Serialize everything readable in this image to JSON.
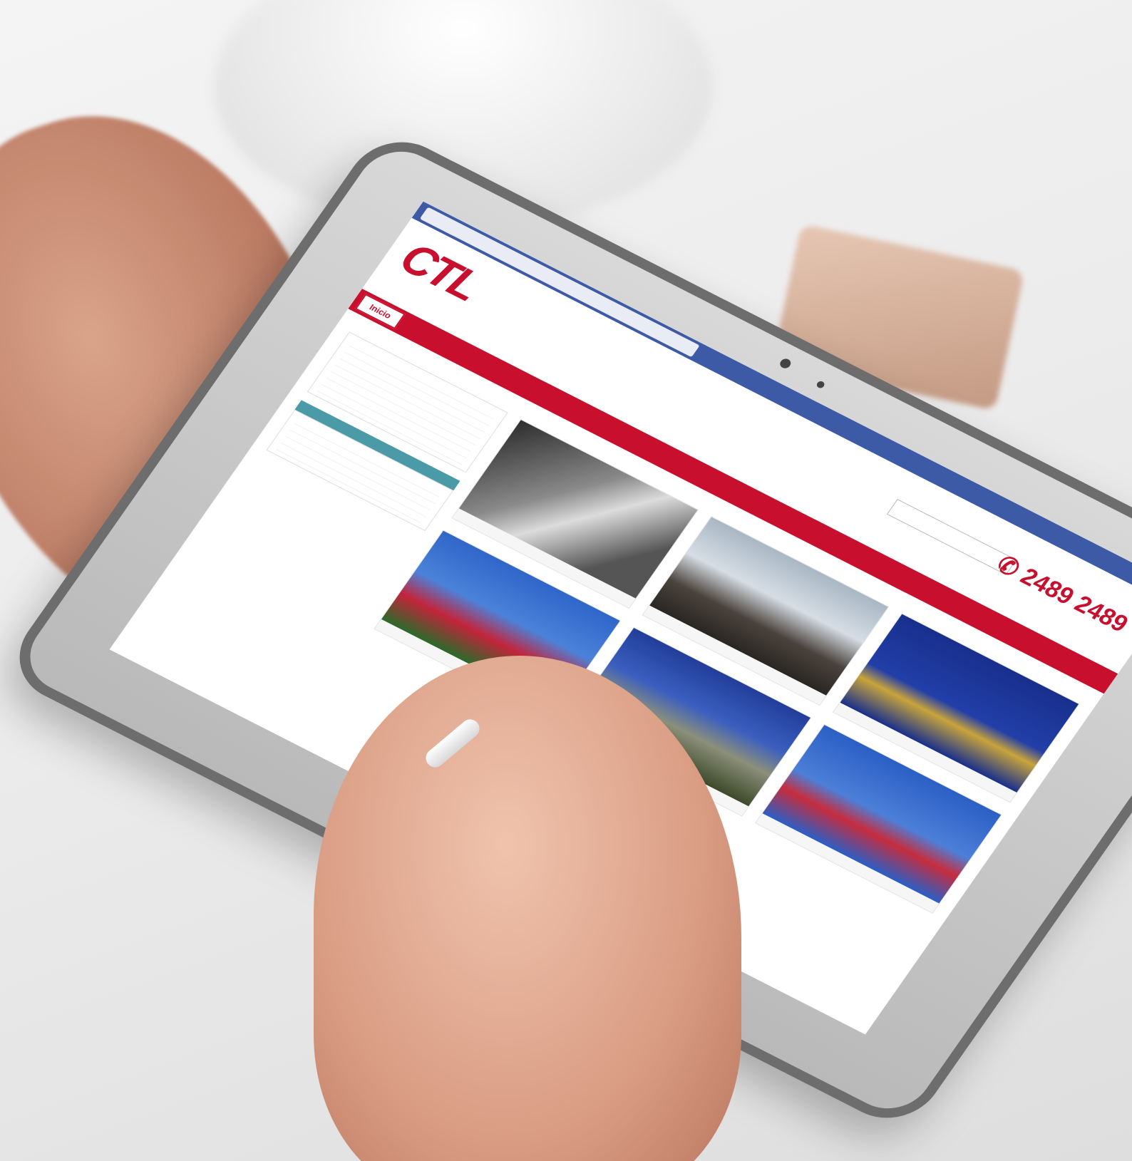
{
  "site": {
    "phone": "2489 2489"
  },
  "nav": {
    "items": [
      {
        "label": "Inicio"
      },
      {
        "label": ""
      },
      {
        "label": ""
      },
      {
        "label": ""
      },
      {
        "label": ""
      },
      {
        "label": ""
      },
      {
        "label": ""
      },
      {
        "label": ""
      }
    ]
  },
  "colors": {
    "brand_red": "#c8102e",
    "browser_blue": "#3d5aa6",
    "title_teal": "#4aa0c0",
    "side_head_teal": "#4a9aa8"
  },
  "icons": [
    "phone-icon",
    "search-icon"
  ]
}
